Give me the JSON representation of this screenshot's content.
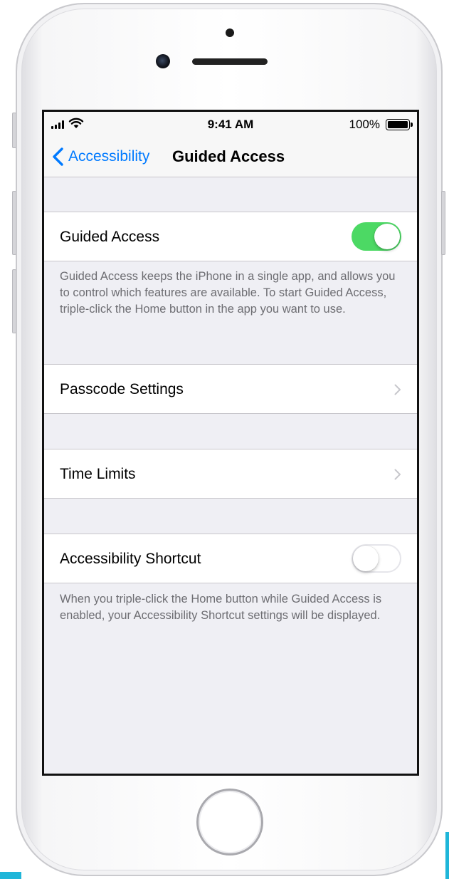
{
  "status_bar": {
    "time": "9:41 AM",
    "battery_percent": "100%",
    "icons": [
      "signal-icon",
      "wifi-icon",
      "battery-icon"
    ]
  },
  "nav": {
    "back_label": "Accessibility",
    "title": "Guided Access",
    "accent_color": "#007aff"
  },
  "rows": {
    "guided_access": {
      "label": "Guided Access",
      "toggle_on": true
    },
    "passcode_settings": {
      "label": "Passcode Settings"
    },
    "time_limits": {
      "label": "Time Limits"
    },
    "accessibility_shortcut": {
      "label": "Accessibility Shortcut",
      "toggle_on": false
    }
  },
  "footers": {
    "guided_access": "Guided Access keeps the iPhone in a single app, and allows you to control which features are available. To start Guided Access, triple-click the Home button in the app you want to use.",
    "accessibility_shortcut": "When you triple-click the Home button while Guided Access is enabled, your Accessibility Shortcut settings will be displayed."
  },
  "colors": {
    "toggle_on": "#4cd964",
    "background": "#efeff4",
    "footer_text": "#6d6d72"
  }
}
